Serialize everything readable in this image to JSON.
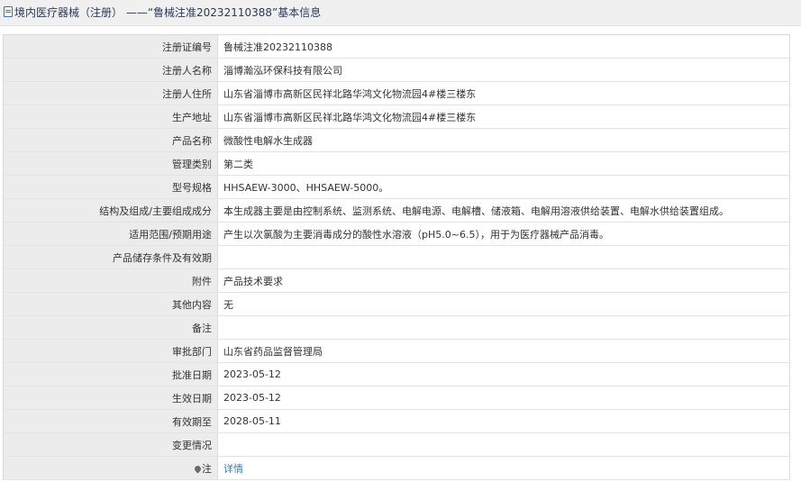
{
  "header": {
    "title": "境内医疗器械（注册）  ——“鲁械注准20232110388”基本信息"
  },
  "rows": [
    {
      "label": "注册证编号",
      "value": "鲁械注准20232110388"
    },
    {
      "label": "注册人名称",
      "value": "淄博瀚泓环保科技有限公司"
    },
    {
      "label": "注册人住所",
      "value": "山东省淄博市高新区民祥北路华鸿文化物流园4#楼三楼东"
    },
    {
      "label": "生产地址",
      "value": "山东省淄博市高新区民祥北路华鸿文化物流园4#楼三楼东"
    },
    {
      "label": "产品名称",
      "value": "微酸性电解水生成器"
    },
    {
      "label": "管理类别",
      "value": "第二类"
    },
    {
      "label": "型号规格",
      "value": "HHSAEW-3000、HHSAEW-5000。"
    },
    {
      "label": "结构及组成/主要组成成分",
      "value": "本生成器主要是由控制系统、监测系统、电解电源、电解槽、储液箱、电解用溶液供给装置、电解水供给装置组成。"
    },
    {
      "label": "适用范围/预期用途",
      "value": "产生以次氯酸为主要消毒成分的酸性水溶液（pH5.0~6.5），用于为医疗器械产品消毒。"
    },
    {
      "label": "产品储存条件及有效期",
      "value": ""
    },
    {
      "label": "附件",
      "value": "产品技术要求"
    },
    {
      "label": "其他内容",
      "value": "无"
    },
    {
      "label": "备注",
      "value": ""
    },
    {
      "label": "审批部门",
      "value": "山东省药品监督管理局"
    },
    {
      "label": "批准日期",
      "value": "2023-05-12"
    },
    {
      "label": "生效日期",
      "value": "2023-05-12"
    },
    {
      "label": "有效期至",
      "value": "2028-05-11"
    },
    {
      "label": "变更情况",
      "value": ""
    }
  ],
  "note": {
    "label": "注",
    "link_text": "详情",
    "icon": "pin-icon"
  },
  "colors": {
    "label_bg": "#ececec",
    "link": "#2f7cc7",
    "title_text": "#2b3a55"
  }
}
